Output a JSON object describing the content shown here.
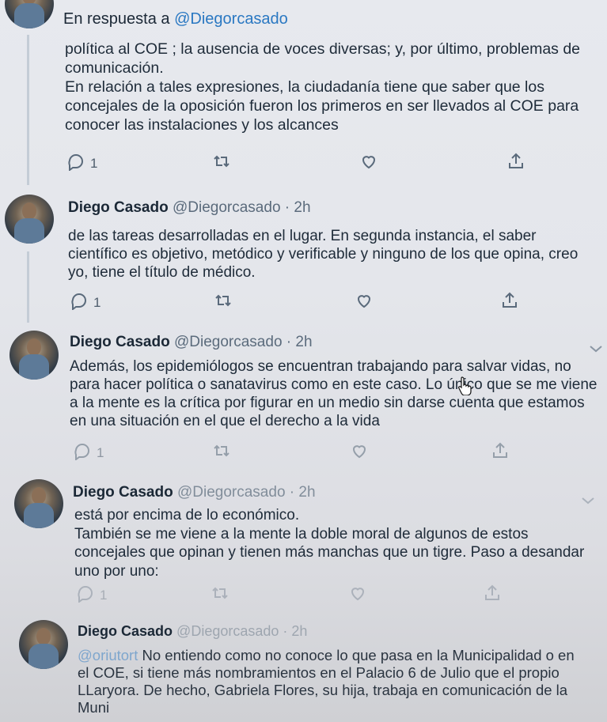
{
  "tweets": [
    {
      "reply_prefix": "En respuesta a",
      "reply_mention": "@Diegorcasado",
      "text": "política al COE ; la ausencia de voces diversas; y, por último, problemas de comunicación.\nEn relación a tales expresiones, la ciudadanía tiene que saber que los concejales de la oposición fueron los primeros en ser llevados al COE para conocer las instalaciones y los alcances",
      "reply_count": "1"
    },
    {
      "name": "Diego Casado",
      "handle": "@Diegorcasado",
      "time": "· 2h",
      "text": "de las tareas desarrolladas en el lugar. En segunda instancia, el saber científico es objetivo, metódico y verificable y ninguno de los que opina, creo yo, tiene el título de médico.",
      "reply_count": "1"
    },
    {
      "name": "Diego Casado",
      "handle": "@Diegorcasado",
      "time": "· 2h",
      "text": "Además, los epidemiólogos se encuentran trabajando para salvar vidas, no para hacer política o sanatavirus como en este caso. Lo único que se me viene a la mente es la crítica por figurar en un medio sin darse cuenta que estamos en una situación en el que el derecho a la vida",
      "reply_count": "1"
    },
    {
      "name": "Diego Casado",
      "handle": "@Diegorcasado",
      "time": "· 2h",
      "text": "está por encima de lo económico.\nTambién se me viene a la mente la doble moral de algunos de estos concejales que opinan y tienen más manchas que un tigre. Paso a desandar uno por uno:",
      "reply_count": "1"
    },
    {
      "name": "Diego Casado",
      "handle": "@Diegorcasado",
      "time": "· 2h",
      "mention": "@oriutort",
      "text": " No entiendo como no conoce lo que pasa en la Municipalidad o en el COE, si tiene más nombramientos en el Palacio 6 de Julio que el propio LLaryora. De hecho, Gabriela Flores, su hija,  trabaja en comunicación de la Muni"
    }
  ],
  "icons": {
    "reply": "reply-icon",
    "retweet": "retweet-icon",
    "like": "heart-icon",
    "share": "share-icon",
    "more": "chevron-down-icon"
  },
  "colors": {
    "mention": "#2a78c2",
    "secondary_text": "#5b6b7c",
    "thread_line": "#c4ccd6"
  }
}
